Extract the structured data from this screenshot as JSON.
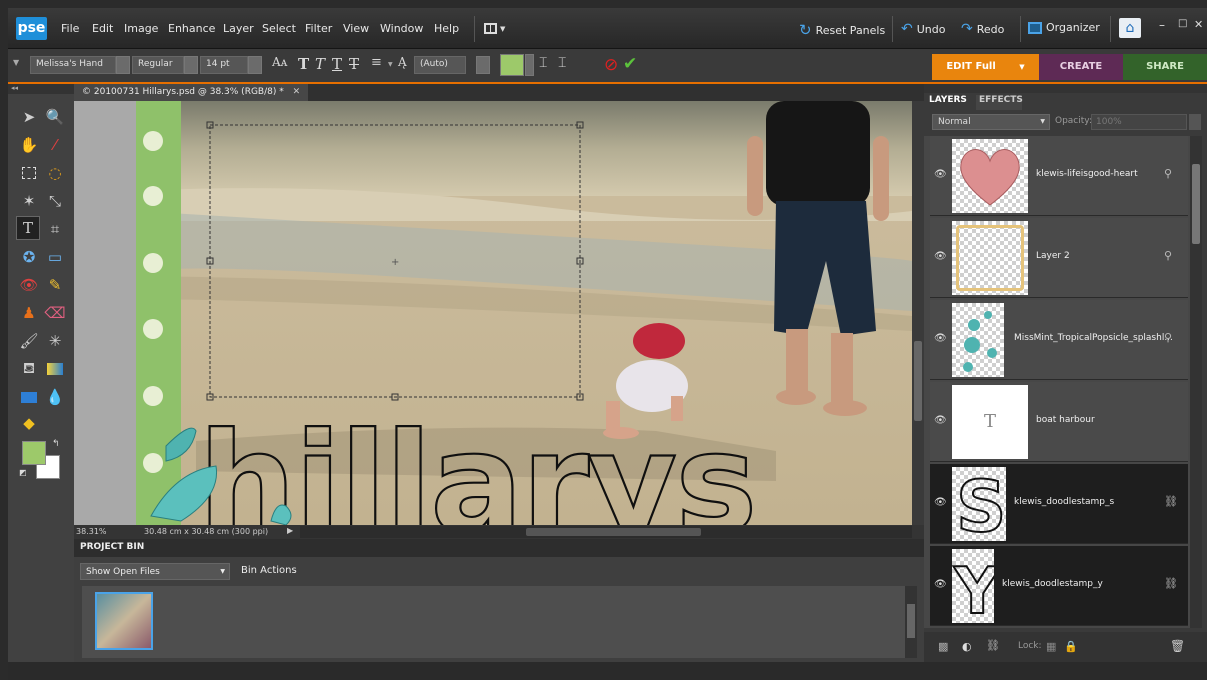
{
  "app": {
    "logo": "pse",
    "menu": [
      "File",
      "Edit",
      "Image",
      "Enhance",
      "Layer",
      "Select",
      "Filter",
      "View",
      "Window",
      "Help"
    ],
    "reset_panels": "Reset Panels",
    "undo": "Undo",
    "redo": "Redo",
    "organizer": "Organizer",
    "window_controls": [
      "–",
      "□",
      "✕"
    ]
  },
  "options": {
    "font_family": "Melissa's Hand",
    "font_style": "Regular",
    "font_size": "14 pt",
    "leading": "(Auto)",
    "text_color": "#9dc96a"
  },
  "modes": {
    "edit": "EDIT Full",
    "create": "CREATE",
    "share": "SHARE"
  },
  "document": {
    "tab_title": "© 20100731 Hillarys.psd @ 38.3% (RGB/8) *",
    "zoom": "38.31%",
    "dimensions": "30.48 cm x 30.48 cm (300 ppi)",
    "headline_text": "hillarys"
  },
  "swatches": {
    "foreground": "#9dc96a",
    "background": "#ffffff"
  },
  "project_bin": {
    "title": "PROJECT BIN",
    "show_select": "Show Open Files",
    "bin_actions": "Bin Actions"
  },
  "layers_panel": {
    "tabs": [
      "LAYERS",
      "EFFECTS"
    ],
    "blend_mode": "Normal",
    "opacity_label": "Opacity:",
    "opacity_value": "100%",
    "lock_label": "Lock:",
    "layers": [
      {
        "name": "klewis-lifeisgood-heart",
        "thumb": "heart"
      },
      {
        "name": "Layer 2",
        "thumb": "frame"
      },
      {
        "name": "MissMint_TropicalPopsicle_splashl...",
        "thumb": "splash"
      },
      {
        "name": "boat harbour",
        "thumb": "text-T"
      },
      {
        "name": "klewis_doodlestamp_s",
        "thumb": "letter-s"
      },
      {
        "name": "klewis_doodlestamp_y",
        "thumb": "letter-y"
      }
    ]
  }
}
